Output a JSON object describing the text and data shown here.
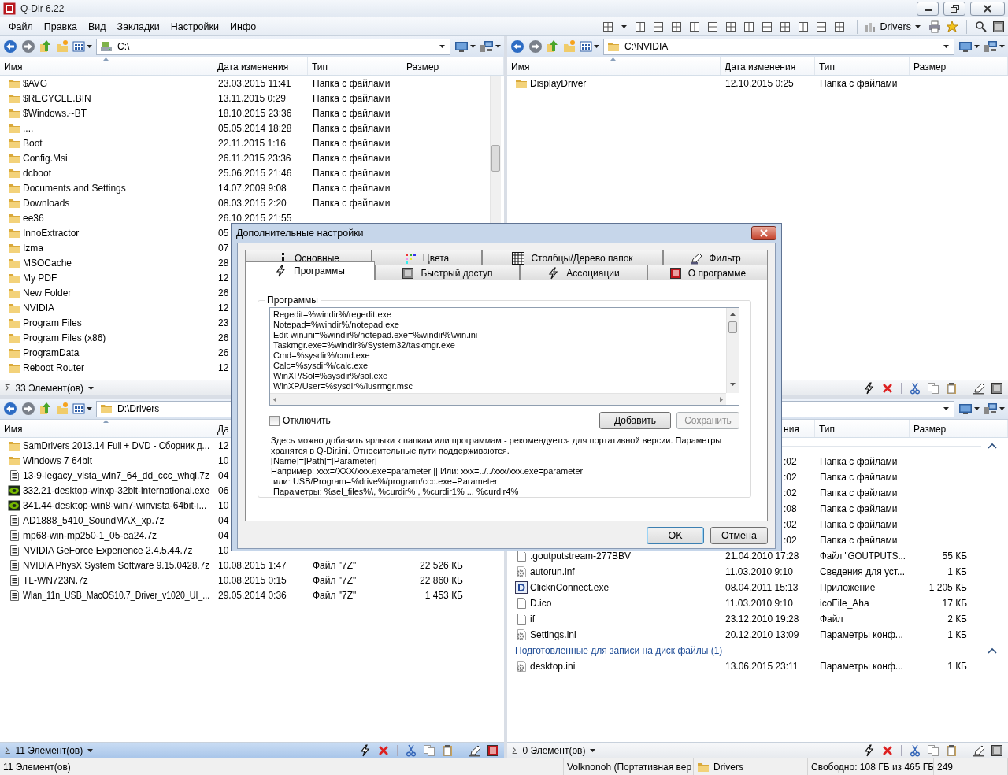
{
  "window": {
    "title": "Q-Dir 6.22"
  },
  "menu": [
    "Файл",
    "Правка",
    "Вид",
    "Закладки",
    "Настройки",
    "Инфо"
  ],
  "toolbar": {
    "favorite": "Drivers"
  },
  "panels": [
    {
      "active": false,
      "toolbar": {
        "nav": true,
        "kind": "drive",
        "path": "C:\\",
        "tools": true
      },
      "columns": [
        {
          "label": "Имя"
        },
        {
          "label": "Дата изменения"
        },
        {
          "label": "Тип"
        },
        {
          "label": "Размер"
        }
      ],
      "rows": [
        {
          "kind": "folder",
          "cells": [
            "$AVG",
            "23.03.2015 11:41",
            "Папка с файлами",
            null
          ]
        },
        {
          "kind": "folder",
          "cells": [
            "$RECYCLE.BIN",
            "13.11.2015 0:29",
            "Папка с файлами",
            null
          ]
        },
        {
          "kind": "folder",
          "cells": [
            "$Windows.~BT",
            "18.10.2015 23:36",
            "Папка с файлами",
            null
          ]
        },
        {
          "kind": "folder",
          "cells": [
            "....",
            "05.05.2014 18:28",
            "Папка с файлами",
            null
          ]
        },
        {
          "kind": "folder",
          "cells": [
            "Boot",
            "22.11.2015 1:16",
            "Папка с файлами",
            null
          ]
        },
        {
          "kind": "folder",
          "cells": [
            "Config.Msi",
            "26.11.2015 23:36",
            "Папка с файлами",
            null
          ]
        },
        {
          "kind": "folder",
          "cells": [
            "dcboot",
            "25.06.2015 21:46",
            "Папка с файлами",
            null
          ]
        },
        {
          "kind": "folder",
          "cells": [
            "Documents and Settings",
            "14.07.2009 9:08",
            "Папка с файлами",
            null
          ]
        },
        {
          "kind": "folder",
          "cells": [
            "Downloads",
            "08.03.2015 2:20",
            "Папка с файлами",
            null
          ]
        },
        {
          "kind": "folder",
          "cells": [
            "ee36",
            "26.10.2015 21:55",
            null,
            null
          ]
        },
        {
          "kind": "folder",
          "cells": [
            "InnoExtractor",
            "05",
            null,
            null
          ]
        },
        {
          "kind": "folder",
          "cells": [
            "Izma",
            "07",
            null,
            null
          ]
        },
        {
          "kind": "folder",
          "cells": [
            "MSOCache",
            "28",
            null,
            null
          ]
        },
        {
          "kind": "folder",
          "cells": [
            "My PDF",
            "12",
            null,
            null
          ]
        },
        {
          "kind": "folder",
          "cells": [
            "New Folder",
            "26",
            null,
            null
          ]
        },
        {
          "kind": "folder",
          "cells": [
            "NVIDIA",
            "12",
            null,
            null
          ]
        },
        {
          "kind": "folder",
          "cells": [
            "Program Files",
            "23",
            null,
            null
          ]
        },
        {
          "kind": "folder",
          "cells": [
            "Program Files (x86)",
            "26",
            null,
            null
          ]
        },
        {
          "kind": "folder",
          "cells": [
            "ProgramData",
            "26",
            null,
            null
          ]
        },
        {
          "kind": "folder",
          "cells": [
            "Reboot Router",
            "12",
            null,
            null
          ]
        }
      ],
      "status": {
        "sum": "Σ",
        "count": "33 Элемент(ов)"
      }
    },
    {
      "active": false,
      "toolbar": {
        "nav": true,
        "kind": "folder",
        "path": "C:\\NVIDIA",
        "tools": true
      },
      "columns": [
        {
          "label": "Имя"
        },
        {
          "label": "Дата изменения"
        },
        {
          "label": "Тип"
        },
        {
          "label": "Размер"
        }
      ],
      "rows": [
        {
          "kind": "folder",
          "cells": [
            "DisplayDriver",
            "12.10.2015 0:25",
            "Папка с файлами",
            null
          ]
        }
      ],
      "status": {
        "tools": true
      }
    },
    {
      "active": true,
      "toolbar": {
        "nav": true,
        "kind": "folder",
        "path": "D:\\Drivers",
        "tools": false
      },
      "columns": [
        {
          "label": "Имя"
        },
        {
          "label": "Да"
        },
        null,
        null
      ],
      "rows": [
        {
          "kind": "folder",
          "cells": [
            "SamDrivers 2013.14 Full + DVD - Сборник д...",
            "12",
            null,
            null
          ]
        },
        {
          "kind": "folder",
          "cells": [
            "Windows 7 64bit",
            "10",
            null,
            null
          ]
        },
        {
          "kind": "archive",
          "cells": [
            "13-9-legacy_vista_win7_64_dd_ccc_whql.7z",
            "04",
            null,
            null
          ]
        },
        {
          "kind": "program",
          "cells": [
            "332.21-desktop-winxp-32bit-international.exe",
            "06",
            null,
            null
          ]
        },
        {
          "kind": "program",
          "cells": [
            "341.44-desktop-win8-win7-winvista-64bit-i...",
            "10",
            null,
            null
          ]
        },
        {
          "kind": "archive",
          "cells": [
            "AD1888_5410_SoundMAX_xp.7z",
            "04",
            null,
            null
          ]
        },
        {
          "kind": "archive",
          "cells": [
            "mp68-win-mp250-1_05-ea24.7z",
            "04",
            null,
            null
          ]
        },
        {
          "kind": "archive",
          "cells": [
            "NVIDIA GeForce Experience 2.4.5.44.7z",
            "10",
            null,
            null
          ]
        },
        {
          "kind": "archive",
          "cells": [
            "NVIDIA PhysX System Software 9.15.0428.7z",
            "10.08.2015 1:47",
            "Файл \"7Z\"",
            "22 526 КБ"
          ]
        },
        {
          "kind": "archive",
          "cells": [
            "TL-WN723N.7z",
            "10.08.2015 0:15",
            "Файл \"7Z\"",
            "22 860 КБ"
          ]
        },
        {
          "kind": "archive",
          "cells": [
            "Wlan_11n_USB_MacOS10.7_Driver_v1020_UI_...",
            "29.05.2014 0:36",
            "Файл \"7Z\"",
            "1 453 КБ"
          ]
        }
      ],
      "status": {
        "sum": "Σ",
        "count": "11 Элемент(ов)",
        "tools": true
      }
    },
    {
      "active": false,
      "toolbar": {
        "nav": false,
        "tools": true
      },
      "columns": [
        null,
        {
          "label": "ния",
          "clipped": true
        },
        {
          "label": "Тип"
        },
        {
          "label": "Размер"
        }
      ],
      "groups": [
        {
          "expanded": true,
          "rows": [
            {
              "clipped": true,
              "cells": [
                null,
                ":02",
                "Папка с файлами",
                null
              ]
            },
            {
              "clipped": true,
              "cells": [
                null,
                ":02",
                "Папка с файлами",
                null
              ]
            },
            {
              "clipped": true,
              "cells": [
                null,
                ":02",
                "Папка с файлами",
                null
              ]
            },
            {
              "clipped": true,
              "cells": [
                null,
                ":08",
                "Папка с файлами",
                null
              ]
            },
            {
              "clipped": true,
              "cells": [
                null,
                ":02",
                "Папка с файлами",
                null
              ]
            },
            {
              "clipped": true,
              "cells": [
                null,
                ":02",
                "Папка с файлами",
                null
              ]
            },
            {
              "kind": "file",
              "cells": [
                ".goutputstream-277BBV",
                "21.04.2010 17:28",
                "Файл \"GOUTPUTS...",
                "55 КБ"
              ]
            },
            {
              "kind": "settings",
              "cells": [
                "autorun.inf",
                "11.03.2010 9:10",
                "Сведения для уст...",
                "1 КБ"
              ]
            },
            {
              "kind": "app",
              "cells": [
                "ClicknConnect.exe",
                "08.04.2011 15:13",
                "Приложение",
                "1 205 КБ"
              ]
            },
            {
              "kind": "file",
              "cells": [
                "D.ico",
                "11.03.2010 9:10",
                "icoFile_Aha",
                "17 КБ"
              ]
            },
            {
              "kind": "file",
              "cells": [
                "if",
                "23.12.2010 19:28",
                "Файл",
                "2 КБ"
              ]
            },
            {
              "kind": "settings",
              "cells": [
                "Settings.ini",
                "20.12.2010 13:09",
                "Параметры конф...",
                "1 КБ"
              ]
            }
          ]
        },
        {
          "label": "Подготовленные для записи на диск файлы (1)",
          "expanded": true,
          "rows": [
            {
              "kind": "settings",
              "cells": [
                "desktop.ini",
                "13.06.2015 23:11",
                "Параметры конф...",
                "1 КБ"
              ]
            }
          ]
        }
      ],
      "status": {
        "sum": "Σ",
        "count": "0 Элемент(ов)",
        "tools": true
      }
    }
  ],
  "status_bar": [
    {
      "kind": "text",
      "text": "11 Элемент(ов)"
    },
    {
      "kind": "text",
      "text": "Volknonoh (Портативная вер"
    },
    {
      "kind": "folder",
      "text": "Drivers"
    },
    {
      "kind": "text",
      "text": "Свободно: 108 ГБ из 465 ГБ"
    },
    {
      "kind": "text",
      "text": "249"
    }
  ],
  "dialog": {
    "title": "Дополнительные настройки",
    "tab_rows": [
      [
        {
          "kind": "info",
          "label": "Основные",
          "selected": false
        },
        {
          "kind": "colors",
          "label": "Цвета",
          "selected": false
        },
        {
          "kind": "columns",
          "label": "Столбцы/Дерево папок",
          "selected": false
        },
        {
          "kind": "filter",
          "label": "Фильтр",
          "selected": false
        }
      ],
      [
        {
          "kind": "lightning",
          "label": "Программы",
          "selected": true
        },
        {
          "kind": "quick",
          "label": "Быстрый доступ",
          "selected": false
        },
        {
          "kind": "lightning",
          "label": "Ассоциации",
          "selected": false
        },
        {
          "kind": "about",
          "label": "О программе",
          "selected": false
        }
      ]
    ],
    "group_title": "Программы",
    "programs": [
      "Regedit=%windir%/regedit.exe",
      "Notepad=%windir%/notepad.exe",
      "Edit win.ini=%windir%/notepad.exe=%windir%\\win.ini",
      "Taskmgr.exe=%windir%/System32/taskmgr.exe",
      "Cmd=%sysdir%/cmd.exe",
      "Calc=%sysdir%/calc.exe",
      "WinXP/Sol=%sysdir%/sol.exe",
      "WinXP/User=%sysdir%/lusrmgr.msc"
    ],
    "disable": {
      "label": "Отключить",
      "checked": false
    },
    "buttons": [
      {
        "label": "Добавить",
        "disabled": false
      },
      {
        "label": "Сохранить",
        "disabled": true
      }
    ],
    "help": [
      "Здесь можно добавить ярлыки к папкам или программам - рекомендуется для портативной версии. Параметры",
      "хранятся в Q-Dir.ini. Относительные пути поддерживаются.",
      "[Name]=[Path]=[Parameter]",
      "Например: xxx=/XXX/xxx.exe=parameter || Или: xxx=../../xxx/xxx.exe=parameter",
      " или: USB/Program=%drive%/program/ccc.exe=Parameter",
      " Параметры: %sel_files%\\, %curdir% , %curdir1% ... %curdir4%"
    ],
    "footer_buttons": [
      {
        "label": "OK",
        "default": true
      },
      {
        "label": "Отмена",
        "default": false
      }
    ]
  }
}
